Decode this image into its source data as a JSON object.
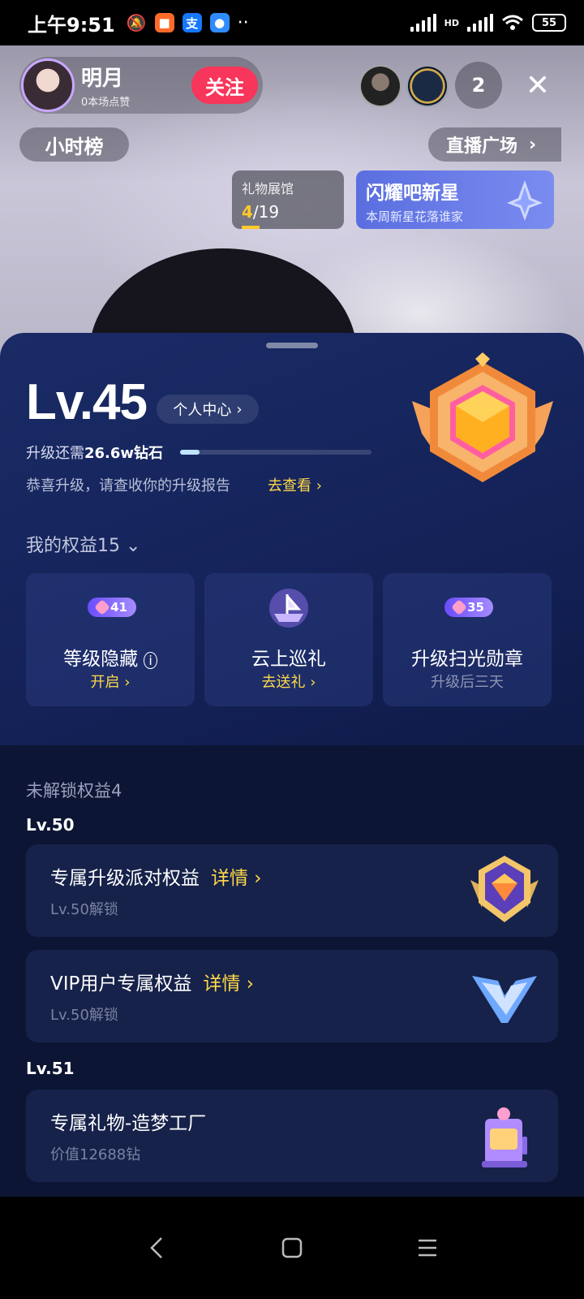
{
  "status_bar": {
    "time": "上午9:51",
    "network": "HD",
    "battery": "55"
  },
  "live": {
    "anchor_name": "明月",
    "anchor_likes": "0本场点赞",
    "follow_label": "关注",
    "viewer_count": "2",
    "hour_rank_label": "小时榜",
    "plaza_label": "直播广场",
    "gift_hall": {
      "title": "礼物展馆",
      "current": "4",
      "total": "/19"
    },
    "star_banner": {
      "title": "闪耀吧新星",
      "subtitle": "本周新星花落谁家"
    }
  },
  "level": {
    "value": "Lv.45",
    "center_label": "个人中心",
    "upgrade_prefix": "升级还需",
    "upgrade_amount": "26.6w钻石",
    "progress_fraction": 0.1,
    "congrats_text": "恭喜升级，请查收你的升级报告",
    "congrats_link": "去查看"
  },
  "rights": {
    "title": "我的权益15",
    "cards": [
      {
        "badge": "41",
        "title": "等级隐藏",
        "sub": "开启"
      },
      {
        "title": "云上巡礼",
        "sub": "去送礼"
      },
      {
        "badge": "35",
        "title": "升级扫光勋章",
        "sub": "升级后三天"
      }
    ]
  },
  "locked": {
    "title": "未解锁权益4",
    "groups": [
      {
        "level": "Lv.50",
        "items": [
          {
            "title": "专属升级派对权益",
            "link": "详情",
            "sub": "Lv.50解锁",
            "icon": "gold-shield-gem-icon"
          },
          {
            "title": "VIP用户专属权益",
            "link": "详情",
            "sub": "Lv.50解锁",
            "icon": "vip-v-icon"
          }
        ]
      },
      {
        "level": "Lv.51",
        "items": [
          {
            "title": "专属礼物-造梦工厂",
            "sub": "价值12688钻",
            "icon": "dream-factory-gift-icon"
          }
        ]
      }
    ]
  },
  "colors": {
    "accent_gold": "#ffd84a",
    "follow_red": "#f8355a",
    "sheet_top": "#1a2b66"
  }
}
